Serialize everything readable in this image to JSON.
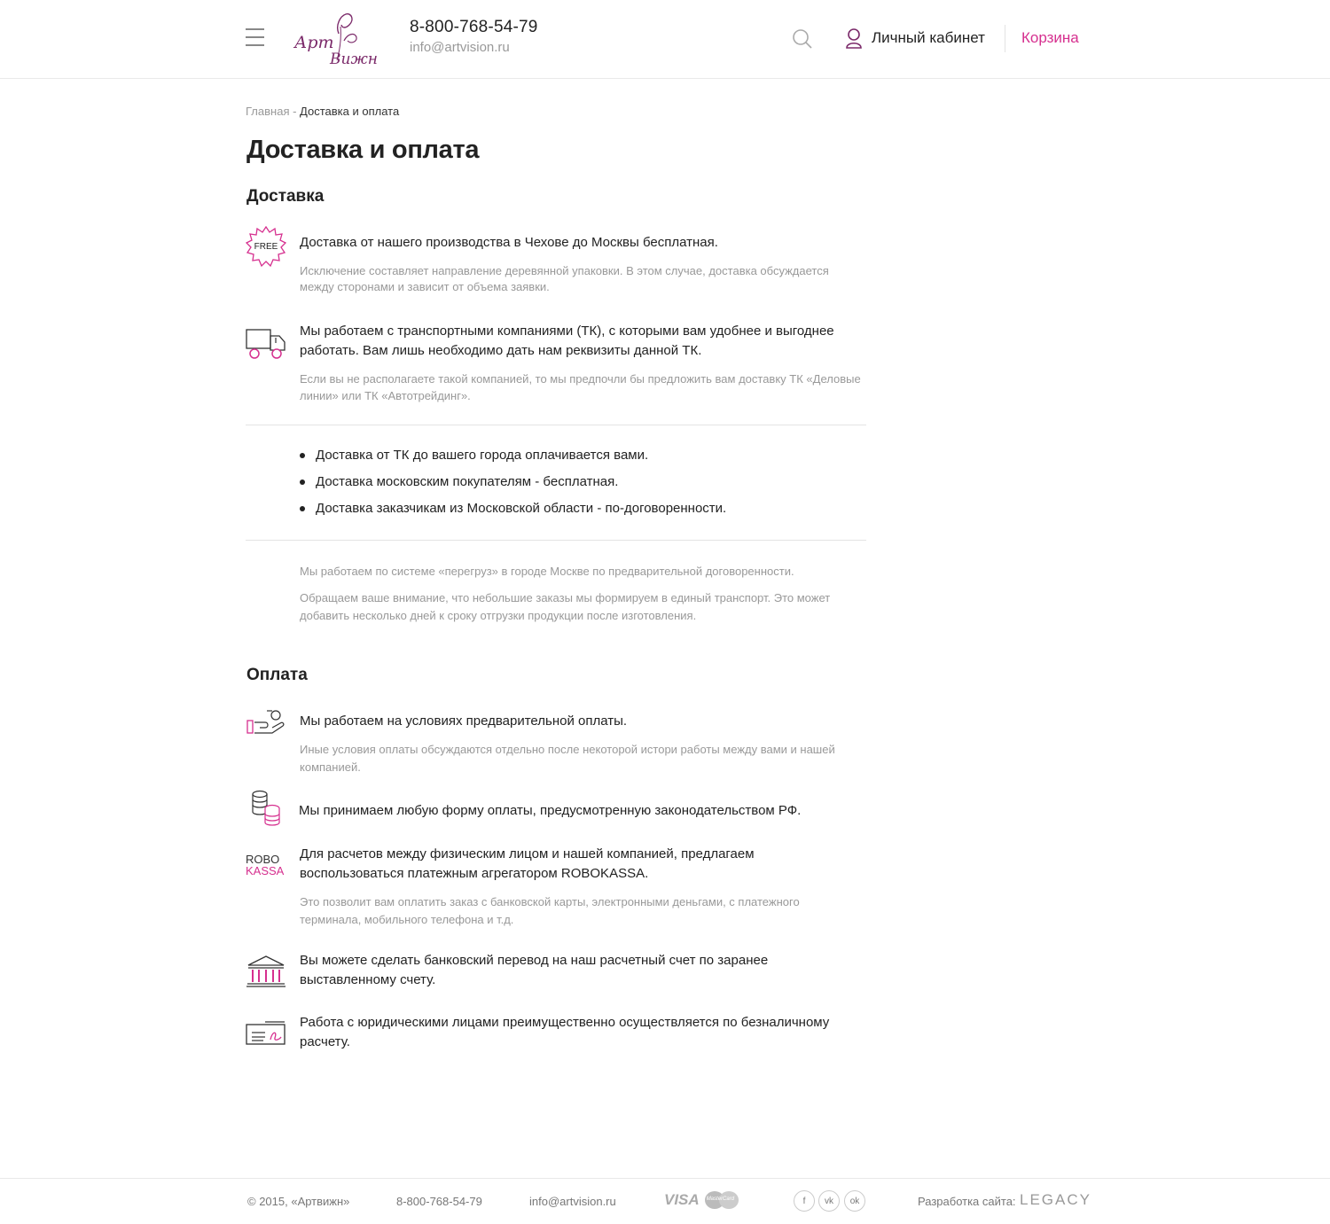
{
  "header": {
    "phone": "8-800-768-54-79",
    "email": "info@artvision.ru",
    "account_label": "Личный кабинет",
    "cart_label": "Корзина",
    "logo_text_top": "Арт",
    "logo_text_bottom": "Вижн"
  },
  "breadcrumb": {
    "home": "Главная",
    "separator": " - ",
    "current": "Доставка и оплата"
  },
  "page_title": "Доставка и оплата",
  "delivery": {
    "title": "Доставка",
    "items": [
      {
        "icon": "free-badge-icon",
        "icon_text": "FREE",
        "main": "Доставка от нашего производства в Чехове до Москвы бесплатная.",
        "sub_line1": "Исключение составляет направление деревянной упаковки. В этом случае, доставка обсуждается",
        "sub_line2": "между сторонами и зависит от объема заявки."
      },
      {
        "icon": "truck-icon",
        "main_line1": "Мы работаем с транспортными компаниями (ТК), с которыми вам удобнее и  выгоднее",
        "main_line2": "работать. Вам лишь необходимо дать нам реквизиты данной ТК.",
        "sub_line1": "Если вы не располагаете такой компанией, то мы предпочли бы предложить вам доставку ТК «Деловые",
        "sub_line2": "линии» или ТК «Автотрейдинг»."
      }
    ],
    "bullets": [
      "Доставка от ТК до вашего города оплачивается вами.",
      "Доставка московским покупателям - бесплатная.",
      "Доставка заказчикам из Московской области - по-договоренности."
    ],
    "notes": {
      "note1": "Мы работаем по системе «перегруз» в городе Москве по предварительной договоренности.",
      "note2_line1": "Обращаем ваше внимание, что небольшие заказы мы формируем в единый транспорт. Это может",
      "note2_line2": "добавить несколько дней к сроку отгрузки продукции после изготовления."
    }
  },
  "payment": {
    "title": "Оплата",
    "items": [
      {
        "icon": "hand-cash-icon",
        "main": "Мы работаем на условиях предварительной оплаты.",
        "sub_line1": "Иные условия оплаты обсуждаются отдельно после некоторой истори работы между вами и нашей",
        "sub_line2": "компанией."
      },
      {
        "icon": "coins-icon",
        "main": "Мы принимаем любую форму оплаты, предусмотренную законодательством РФ."
      },
      {
        "icon": "robokassa-logo",
        "logo_top": "ROBO",
        "logo_bottom": "KASSA",
        "main_line1": "Для расчетов между физическим лицом и нашей компанией, предлагаем",
        "main_line2": "воспользоваться платежным агрегатором ROBOKASSA.",
        "sub_line1": "Это позволит вам оплатить заказ с банковской карты, электронными деньгами, с платежного",
        "sub_line2": "терминала, мобильного телефона и т.д."
      },
      {
        "icon": "bank-icon",
        "main_line1": "Вы можете сделать банковский перевод на наш расчетный счет по заранее",
        "main_line2": "выставленному счету."
      },
      {
        "icon": "check-document-icon",
        "main_line1": "Работа с юридическими лицами преимущественно осуществляется по безналичному",
        "main_line2": "расчету."
      }
    ]
  },
  "footer": {
    "copyright": "© 2015, «Артвижн»",
    "phone": "8-800-768-54-79",
    "email": "info@artvision.ru",
    "visa": "VISA",
    "mastercard": "MasterCard",
    "social": [
      "f",
      "vk",
      "ok"
    ],
    "dev_label": "Разработка сайта:",
    "dev_name": "LEGACY"
  },
  "colors": {
    "accent": "#d6308f",
    "logo": "#7b2a6a",
    "muted": "#999999",
    "text": "#222222"
  }
}
